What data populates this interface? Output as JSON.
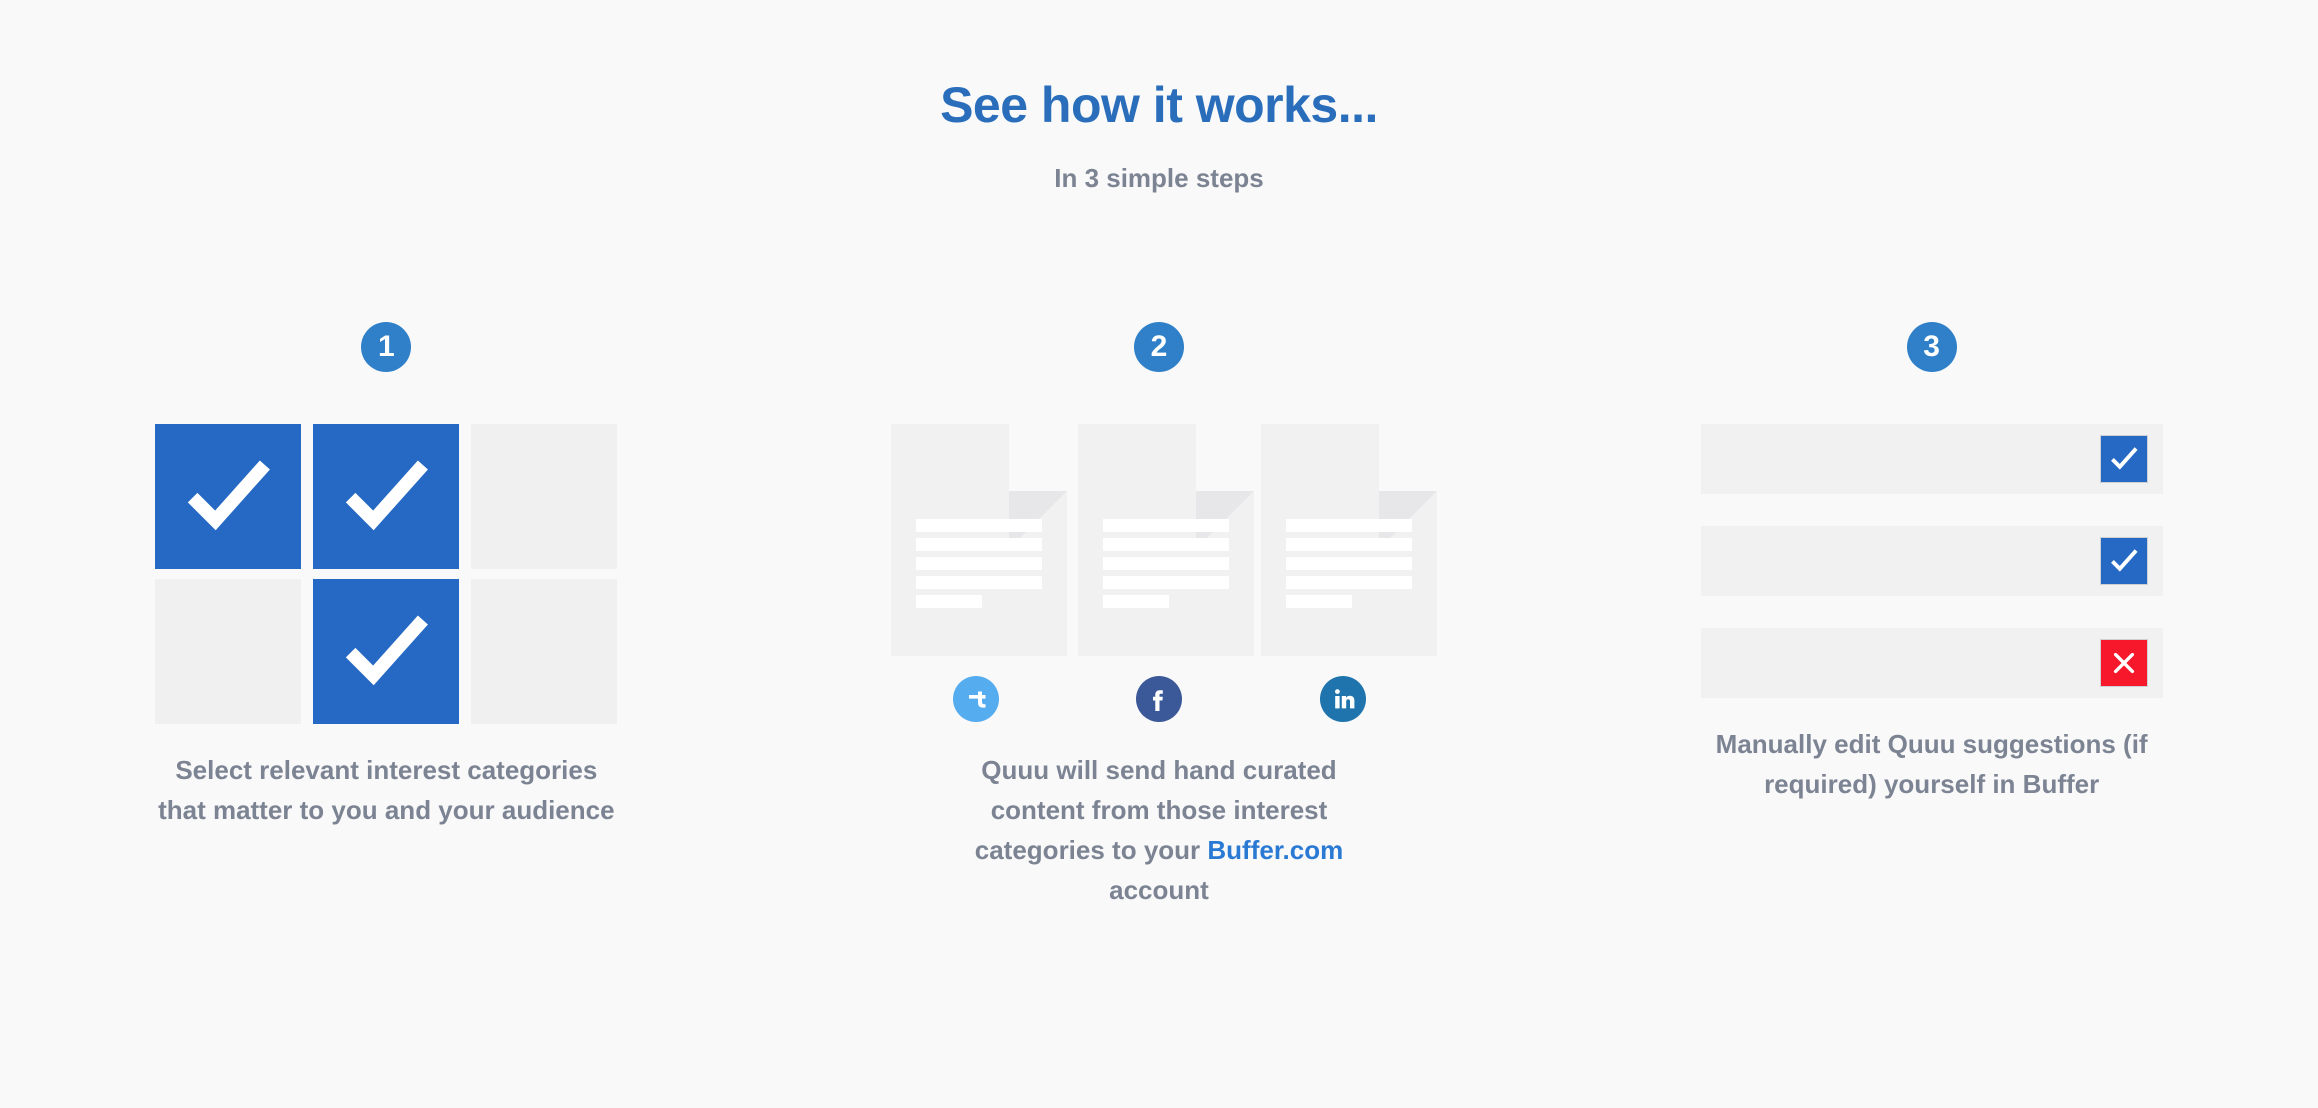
{
  "header": {
    "title": "See how it works...",
    "subtitle": "In 3 simple steps"
  },
  "colors": {
    "background": "#f9f9fa",
    "title_blue": "#2a6ebb",
    "badge_blue": "#2f80c8",
    "tile_blue": "#2569c4",
    "tile_gray": "#f0f0f0",
    "doc_gray": "#f1f1f2",
    "caption_gray": "#7c8493",
    "link_blue": "#2a7ad4",
    "red": "#f7192b",
    "twitter": "#55acee",
    "facebook": "#3b5998",
    "linkedin": "#1f74ad"
  },
  "steps": [
    {
      "number": "1",
      "icon_name": "interest-category-grid",
      "caption_before": "Select relevant interest categories that matter to you and your audience",
      "link_text": "",
      "caption_after": "",
      "tiles": [
        {
          "label": "category-tile-1",
          "selected": true
        },
        {
          "label": "category-tile-2",
          "selected": true
        },
        {
          "label": "category-tile-3",
          "selected": false
        },
        {
          "label": "category-tile-4",
          "selected": false
        },
        {
          "label": "category-tile-5",
          "selected": true
        },
        {
          "label": "category-tile-6",
          "selected": false
        }
      ]
    },
    {
      "number": "2",
      "icon_name": "curated-content-documents",
      "caption_before": "Quuu will send hand curated content from those interest categories to your ",
      "link_text": "Buffer.com",
      "caption_after": " account",
      "documents": [
        {
          "label": "document-1",
          "lines": 5
        },
        {
          "label": "document-2",
          "lines": 5
        },
        {
          "label": "document-3",
          "lines": 5
        }
      ],
      "socials": [
        {
          "name": "twitter-icon",
          "label": "Twitter",
          "color": "#55acee"
        },
        {
          "name": "facebook-icon",
          "label": "Facebook",
          "color": "#3b5998"
        },
        {
          "name": "linkedin-icon",
          "label": "LinkedIn",
          "color": "#1f74ad"
        }
      ]
    },
    {
      "number": "3",
      "icon_name": "suggestion-review-rows",
      "caption_before": "Manually edit Quuu suggestions (if required) yourself in Buffer",
      "link_text": "",
      "caption_after": "",
      "rows": [
        {
          "label": "suggestion-row-1",
          "state": "approved",
          "glyph": "check"
        },
        {
          "label": "suggestion-row-2",
          "state": "approved",
          "glyph": "check"
        },
        {
          "label": "suggestion-row-3",
          "state": "rejected",
          "glyph": "cross"
        }
      ]
    }
  ]
}
